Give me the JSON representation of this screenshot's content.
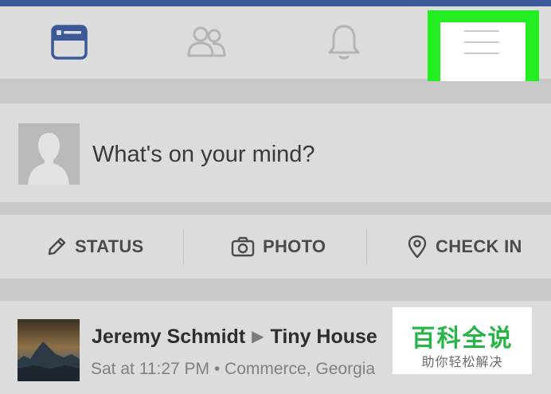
{
  "nav": {
    "icons": [
      "news-feed-icon",
      "friends-icon",
      "notifications-icon",
      "menu-icon"
    ],
    "highlight_color": "#22ee22"
  },
  "composer": {
    "placeholder": "What's on your mind?"
  },
  "actions": [
    {
      "label": "STATUS",
      "icon": "pencil-icon"
    },
    {
      "label": "PHOTO",
      "icon": "camera-icon"
    },
    {
      "label": "CHECK IN",
      "icon": "location-pin-icon"
    }
  ],
  "post": {
    "author": "Jeremy Schmidt",
    "target": "Tiny House",
    "meta": "Sat at 11:27 PM • Commerce, Georgia"
  },
  "watermark": {
    "title": "百科全说",
    "subtitle": "助你轻松解决"
  }
}
